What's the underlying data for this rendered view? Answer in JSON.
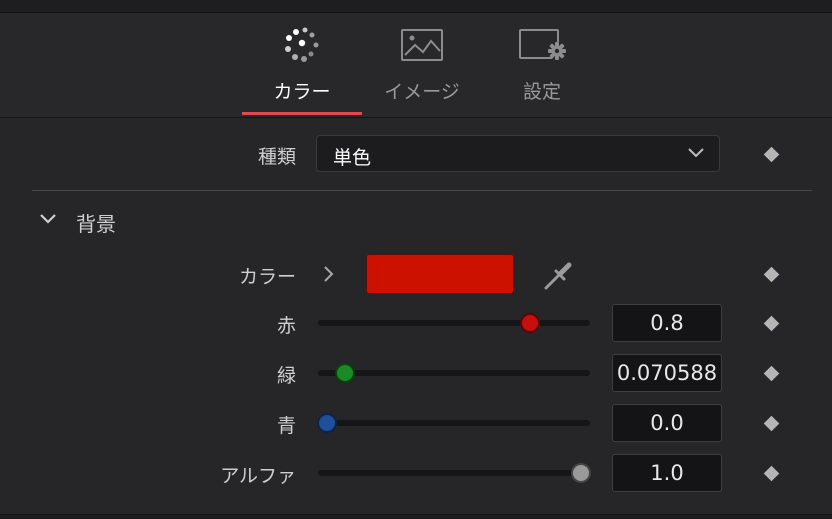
{
  "tabs": [
    {
      "label": "カラー",
      "icon": "color-dots-icon",
      "active": true
    },
    {
      "label": "イメージ",
      "icon": "image-icon",
      "active": false
    },
    {
      "label": "設定",
      "icon": "settings-gear-icon",
      "active": false
    }
  ],
  "type_row": {
    "label": "種類",
    "value": "単色"
  },
  "section": {
    "title": "背景",
    "expanded": true
  },
  "color_row": {
    "label": "カラー",
    "swatch_color": "#cc1100"
  },
  "channels": [
    {
      "label": "赤",
      "value": "0.8",
      "fraction": 0.8,
      "knob_color": "#c80f0f"
    },
    {
      "label": "緑",
      "value": "0.070588",
      "fraction": 0.070588,
      "knob_color": "#1a8a24"
    },
    {
      "label": "青",
      "value": "0.0",
      "fraction": 0.0,
      "knob_color": "#1e4f9a"
    },
    {
      "label": "アルファ",
      "value": "1.0",
      "fraction": 1.0,
      "knob_color": "#9a9a9a"
    }
  ],
  "colors": {
    "accent": "#e24a4a",
    "background": "#262628"
  }
}
